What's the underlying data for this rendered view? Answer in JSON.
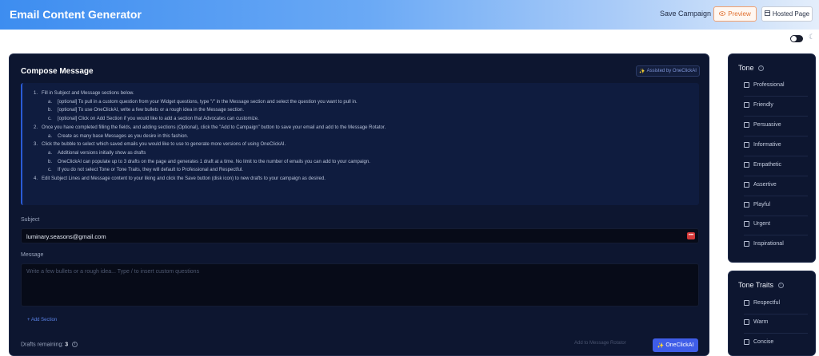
{
  "header": {
    "title": "Email Content Generator",
    "save_campaign": "Save Campaign",
    "preview": "Preview",
    "hosted_page": "Hosted Page"
  },
  "compose": {
    "title": "Compose Message",
    "powered_by": "Assisted by OneClickAI",
    "instructions": {
      "step1": "Fill in Subject and Message sections below.",
      "step1a": "[optional] To pull in a custom question from your Widget questions, type \"/\" in the Message section and select the question you want to pull in.",
      "step1b": "[optional] To use OneClickAI, write a few bullets or a rough idea in the Message section.",
      "step1c": "[optional] Click on Add Section if you would like to add a section that Advocates can customize.",
      "step2": "Once you have completed filling the fields, and adding sections (Optional), click the \"Add to Campaign\" button to save your email and add to the Message Rotator.",
      "step2a": "Create as many base Messages as you desire in this fashion.",
      "step3": "Click the bubble to select which saved emails you would like to use to generate more versions of using OneClickAI.",
      "step3a": "Additional versions initially show as drafts",
      "step3b": "OneClickAI can populate up to 3 drafts on the page and generates 1 draft at a time. No limit to the number of emails you can add to your campaign.",
      "step3c": "If you do not select Tone or Tone Traits, they will default to Professional and Respectful.",
      "step4": "Edit Subject Lines and Message content to your liking and click the Save button (disk icon) to new drafts to your campaign as desired."
    },
    "subject_label": "Subject",
    "subject_value": "luminary.seasons@gmail.com",
    "message_label": "Message",
    "message_placeholder": "Write a few bullets or a rough idea... Type / to insert custom questions",
    "add_section": "+ Add Section",
    "drafts_label": "Drafts remaining:",
    "drafts_count": "3",
    "add_to_rotator": "Add to Message Rotator",
    "oneclick_button": "OneClickAI"
  },
  "tone": {
    "title": "Tone",
    "options": [
      "Professional",
      "Friendly",
      "Persuasive",
      "Informative",
      "Empathetic",
      "Assertive",
      "Playful",
      "Urgent",
      "Inspirational"
    ]
  },
  "tone_traits": {
    "title": "Tone Traits",
    "options": [
      "Respectful",
      "Warm",
      "Concise"
    ]
  },
  "colors": {
    "accent": "#3f5de8",
    "panel_bg": "#0d1630",
    "header_gradient_start": "#3d8df0",
    "preview_orange": "#e07030"
  }
}
